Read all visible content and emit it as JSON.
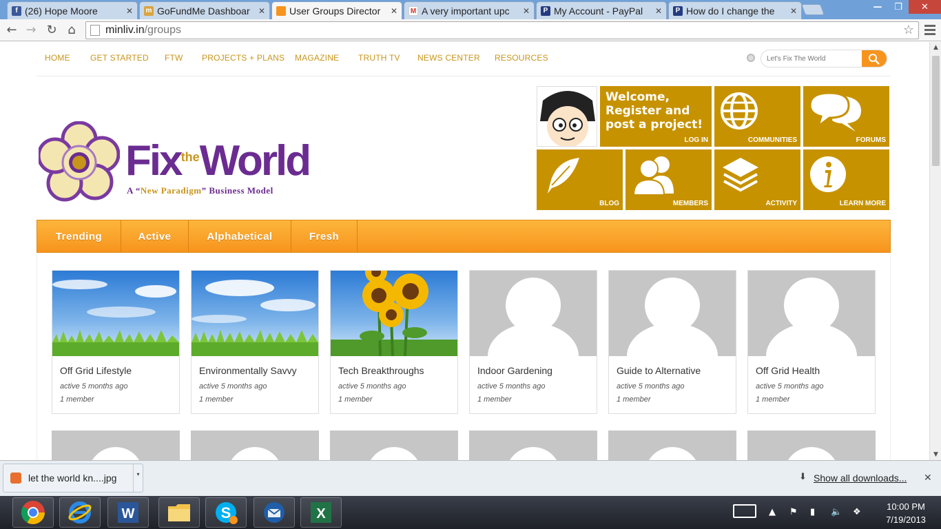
{
  "browser": {
    "tabs": [
      {
        "title": "(26) Hope Moore",
        "favicon": "facebook-icon",
        "color": "#3b5998",
        "active": false
      },
      {
        "title": "GoFundMe Dashboar",
        "favicon": "gofundme-icon",
        "color": "#d9a441",
        "active": false
      },
      {
        "title": "User Groups Director",
        "favicon": "site-icon",
        "color": "#f7941d",
        "active": true
      },
      {
        "title": "A very important upc",
        "favicon": "gmail-icon",
        "color": "#d93025",
        "active": false
      },
      {
        "title": "My Account - PayPal",
        "favicon": "paypal-icon",
        "color": "#253b80",
        "active": false
      },
      {
        "title": "How do I change the",
        "favicon": "paypal-icon",
        "color": "#253b80",
        "active": false
      }
    ],
    "address": {
      "host": "minliv.in",
      "path": "/groups"
    }
  },
  "site": {
    "nav": [
      "HOME",
      "GET STARTED",
      "FTW",
      "PROJECTS + PLANS",
      "MAGAZINE",
      "TRUTH TV",
      "NEWS CENTER",
      "RESOURCES"
    ],
    "search_placeholder": "Let's Fix The World",
    "logo": {
      "fix": "Fix",
      "the": "the",
      "world": "World",
      "tag_a": "A “",
      "tag_new": "New Paradigm",
      "tag_b": "” Business Model"
    },
    "tiles": {
      "welcome": "Welcome, Register and post a project!",
      "login": "LOG IN",
      "communities": "COMMUNITIES",
      "forums": "FORUMS",
      "blog": "BLOG",
      "members": "MEMBERS",
      "activity": "ACTIVITY",
      "learn_more": "LEARN MORE"
    },
    "tile_color": "#c79200",
    "accent": "#f7941d",
    "filters": [
      "Trending",
      "Active",
      "Alphabetical",
      "Fresh"
    ],
    "groups": [
      {
        "name": "Off Grid Lifestyle",
        "active": "active 5 months ago",
        "members": "1 member",
        "image": "sky"
      },
      {
        "name": "Environmentally Savvy",
        "active": "active 5 months ago",
        "members": "1 member",
        "image": "sky"
      },
      {
        "name": "Tech Breakthroughs",
        "active": "active 5 months ago",
        "members": "1 member",
        "image": "sunflowers"
      },
      {
        "name": "Indoor Gardening",
        "active": "active 5 months ago",
        "members": "1 member",
        "image": "placeholder"
      },
      {
        "name": "Guide to Alternative",
        "active": "active 5 months ago",
        "members": "1 member",
        "image": "placeholder"
      },
      {
        "name": "Off Grid Health",
        "active": "active 5 months ago",
        "members": "1 member",
        "image": "placeholder"
      }
    ]
  },
  "downloads": {
    "file": "let the world kn....jpg",
    "show_all": "Show all downloads..."
  },
  "taskbar": {
    "time": "10:00 PM",
    "date": "7/19/2013"
  }
}
